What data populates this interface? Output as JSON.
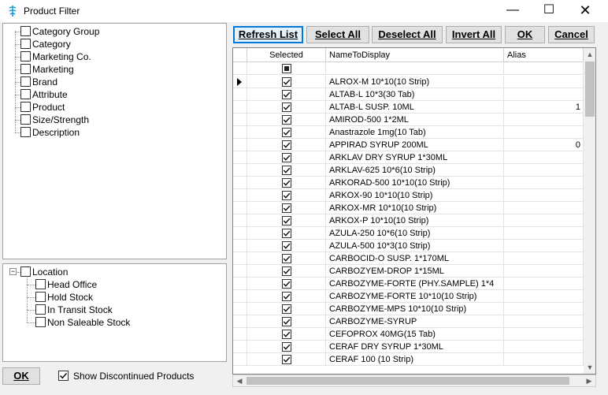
{
  "window": {
    "title": "Product Filter",
    "minimize": "—",
    "maximize": "☐",
    "close": "✕"
  },
  "tree_top": {
    "items": [
      {
        "label": "Category Group",
        "checked": false
      },
      {
        "label": "Category",
        "checked": false
      },
      {
        "label": "Marketing Co.",
        "checked": false
      },
      {
        "label": "Marketing",
        "checked": false
      },
      {
        "label": "Brand",
        "checked": false
      },
      {
        "label": "Attribute",
        "checked": false
      },
      {
        "label": "Product",
        "checked": false
      },
      {
        "label": "Size/Strength",
        "checked": false
      },
      {
        "label": "Description",
        "checked": false
      }
    ]
  },
  "tree_bottom": {
    "root": {
      "label": "Location",
      "expander": "−",
      "checked": false
    },
    "children": [
      {
        "label": "Head Office",
        "checked": false
      },
      {
        "label": "Hold Stock",
        "checked": false
      },
      {
        "label": "In Transit Stock",
        "checked": false
      },
      {
        "label": "Non Saleable Stock",
        "checked": false
      }
    ]
  },
  "toolbar": {
    "refresh": "Refresh List",
    "select_all": "Select All",
    "deselect_all": "Deselect All",
    "invert_all": "Invert All",
    "ok": "OK",
    "cancel": "Cancel"
  },
  "grid": {
    "columns": [
      "Selected",
      "NameToDisplay",
      "Alias"
    ],
    "rows": [
      {
        "name": "ALROX-M 10*10(10 Strip)",
        "alias": "",
        "selected": true,
        "current": true
      },
      {
        "name": "ALTAB-L 10*3(30 Tab)",
        "alias": "",
        "selected": true
      },
      {
        "name": "ALTAB-L SUSP. 10ML",
        "alias": "1",
        "selected": true
      },
      {
        "name": "AMIROD-500 1*2ML",
        "alias": "",
        "selected": true
      },
      {
        "name": "Anastrazole 1mg(10 Tab)",
        "alias": "",
        "selected": true
      },
      {
        "name": "APPIRAD SYRUP 200ML",
        "alias": "0",
        "selected": true
      },
      {
        "name": "ARKLAV DRY SYRUP 1*30ML",
        "alias": "",
        "selected": true
      },
      {
        "name": "ARKLAV-625 10*6(10 Strip)",
        "alias": "",
        "selected": true
      },
      {
        "name": "ARKORAD-500 10*10(10 Strip)",
        "alias": "",
        "selected": true
      },
      {
        "name": "ARKOX-90 10*10(10 Strip)",
        "alias": "",
        "selected": true
      },
      {
        "name": "ARKOX-MR 10*10(10 Strip)",
        "alias": "",
        "selected": true
      },
      {
        "name": "ARKOX-P 10*10(10 Strip)",
        "alias": "",
        "selected": true
      },
      {
        "name": "AZULA-250 10*6(10 Strip)",
        "alias": "",
        "selected": true
      },
      {
        "name": "AZULA-500 10*3(10 Strip)",
        "alias": "",
        "selected": true
      },
      {
        "name": "CARBOCID-O SUSP. 1*170ML",
        "alias": "",
        "selected": true
      },
      {
        "name": "CARBOZYEM-DROP 1*15ML",
        "alias": "",
        "selected": true
      },
      {
        "name": "CARBOZYME-FORTE (PHY.SAMPLE) 1*4",
        "alias": "",
        "selected": true
      },
      {
        "name": "CARBOZYME-FORTE 10*10(10 Strip)",
        "alias": "",
        "selected": true
      },
      {
        "name": "CARBOZYME-MPS 10*10(10 Strip)",
        "alias": "",
        "selected": true
      },
      {
        "name": "CARBOZYME-SYRUP",
        "alias": "",
        "selected": true
      },
      {
        "name": "CEFOPROX 40MG(15 Tab)",
        "alias": "",
        "selected": true
      },
      {
        "name": "CERAF DRY SYRUP 1*30ML",
        "alias": "",
        "selected": true
      },
      {
        "name": "CERAF 100 (10 Strip)",
        "alias": "",
        "selected": true
      }
    ]
  },
  "footer": {
    "ok": "OK",
    "show_discontinued": "Show Discontinued Products",
    "show_discontinued_checked": true
  },
  "colors": {
    "accent": "#0078d7",
    "app_icon": "#1e9fd1"
  }
}
